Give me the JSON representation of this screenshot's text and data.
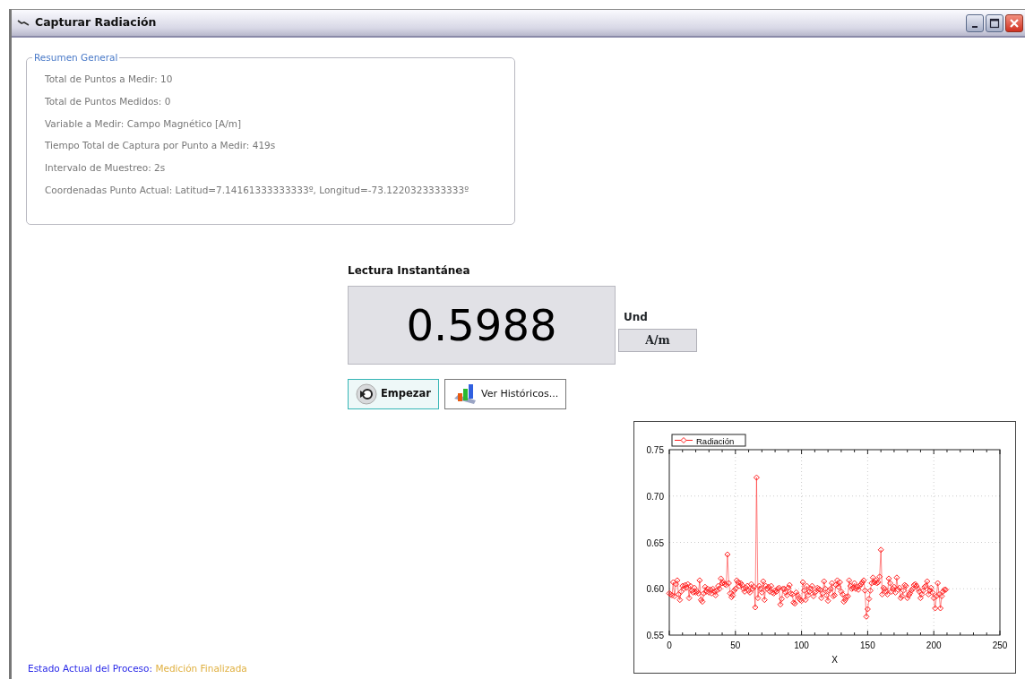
{
  "window": {
    "title": "Capturar Radiación"
  },
  "summary": {
    "legend": "Resumen General",
    "items": [
      "Total de Puntos a Medir: 10",
      "Total de Puntos Medidos: 0",
      "Variable a Medir: Campo Magnético [A/m]",
      "Tiempo Total de Captura por Punto a Medir: 419s",
      "Intervalo de Muestreo: 2s",
      "Coordenadas Punto Actual: Latitud=7.14161333333333º, Longitud=-73.1220323333333º"
    ]
  },
  "reading": {
    "title": "Lectura Instantánea",
    "value": "0.5988",
    "unit_label": "Und",
    "unit": "A/m"
  },
  "buttons": [
    {
      "label": "Empezar",
      "kind": "start"
    },
    {
      "label": "Ver Históricos...",
      "kind": "history"
    }
  ],
  "chart": {
    "chart_data": {
      "type": "line",
      "xlabel": "X",
      "grid": true,
      "xlim": [
        0,
        250
      ],
      "ylim": [
        0.55,
        0.75
      ],
      "x": [
        0,
        1,
        2,
        3,
        4,
        5,
        6,
        7,
        8,
        9,
        10,
        11,
        12,
        13,
        14,
        15,
        16,
        17,
        18,
        19,
        20,
        21,
        22,
        23,
        24,
        25,
        26,
        27,
        28,
        29,
        30,
        31,
        32,
        33,
        34,
        35,
        36,
        37,
        38,
        39,
        40,
        41,
        42,
        43,
        44,
        45,
        46,
        47,
        48,
        49,
        50,
        51,
        52,
        53,
        54,
        55,
        56,
        57,
        58,
        59,
        60,
        61,
        62,
        63,
        64,
        65,
        66,
        67,
        68,
        69,
        70,
        71,
        72,
        73,
        74,
        75,
        76,
        77,
        78,
        79,
        80,
        81,
        82,
        83,
        84,
        85,
        86,
        87,
        88,
        89,
        90,
        91,
        92,
        93,
        94,
        95,
        96,
        97,
        98,
        99,
        100,
        101,
        102,
        103,
        104,
        105,
        106,
        107,
        108,
        109,
        110,
        111,
        112,
        113,
        114,
        115,
        116,
        117,
        118,
        119,
        120,
        121,
        122,
        123,
        124,
        125,
        126,
        127,
        128,
        129,
        130,
        131,
        132,
        133,
        134,
        135,
        136,
        137,
        138,
        139,
        140,
        141,
        142,
        143,
        144,
        145,
        146,
        147,
        148,
        149,
        150,
        151,
        152,
        153,
        154,
        155,
        156,
        157,
        158,
        159,
        160,
        161,
        162,
        163,
        164,
        165,
        166,
        167,
        168,
        169,
        170,
        171,
        172,
        173,
        174,
        175,
        176,
        177,
        178,
        179,
        180,
        181,
        182,
        183,
        184,
        185,
        186,
        187,
        188,
        189,
        190,
        191,
        192,
        193,
        194,
        195,
        196,
        197,
        198,
        199,
        200,
        201,
        202,
        203,
        204,
        205,
        206,
        207,
        208,
        209
      ],
      "xticks": [
        0,
        50,
        100,
        150,
        200,
        250
      ],
      "yticks": [
        {
          "value": 0.55,
          "label": "0.55"
        },
        {
          "value": 0.6,
          "label": "0.60"
        },
        {
          "value": 0.65,
          "label": "0.65"
        },
        {
          "value": 0.7,
          "label": "0.70"
        },
        {
          "value": 0.75,
          "label": "0.75"
        }
      ],
      "series": [
        {
          "name": "Radiación",
          "color": "#ff2020",
          "marker": "diamond",
          "values": [
            0.595,
            0.594,
            0.593,
            0.607,
            0.592,
            0.605,
            0.609,
            0.594,
            0.588,
            0.597,
            0.603,
            0.6,
            0.604,
            0.601,
            0.605,
            0.59,
            0.603,
            0.598,
            0.596,
            0.601,
            0.596,
            0.597,
            0.595,
            0.609,
            0.588,
            0.586,
            0.595,
            0.602,
            0.597,
            0.6,
            0.596,
            0.599,
            0.595,
            0.6,
            0.597,
            0.593,
            0.598,
            0.603,
            0.6,
            0.611,
            0.606,
            0.607,
            0.605,
            0.604,
            0.637,
            0.606,
            0.595,
            0.591,
            0.593,
            0.598,
            0.6,
            0.609,
            0.607,
            0.603,
            0.606,
            0.604,
            0.6,
            0.597,
            0.601,
            0.603,
            0.598,
            0.596,
            0.605,
            0.6,
            0.602,
            0.58,
            0.72,
            0.59,
            0.603,
            0.6,
            0.596,
            0.608,
            0.588,
            0.603,
            0.6,
            0.602,
            0.597,
            0.603,
            0.596,
            0.595,
            0.598,
            0.597,
            0.6,
            0.601,
            0.583,
            0.589,
            0.6,
            0.6,
            0.596,
            0.593,
            0.601,
            0.604,
            0.595,
            0.594,
            0.585,
            0.584,
            0.596,
            0.593,
            0.59,
            0.588,
            0.587,
            0.607,
            0.598,
            0.588,
            0.603,
            0.593,
            0.597,
            0.6,
            0.603,
            0.592,
            0.596,
            0.597,
            0.601,
            0.6,
            0.599,
            0.59,
            0.595,
            0.608,
            0.6,
            0.593,
            0.587,
            0.598,
            0.6,
            0.606,
            0.592,
            0.593,
            0.604,
            0.609,
            0.602,
            0.607,
            0.597,
            0.594,
            0.586,
            0.588,
            0.591,
            0.592,
            0.609,
            0.603,
            0.6,
            0.601,
            0.606,
            0.6,
            0.602,
            0.599,
            0.603,
            0.605,
            0.607,
            0.609,
            0.598,
            0.57,
            0.578,
            0.589,
            0.598,
            0.606,
            0.612,
            0.607,
            0.609,
            0.606,
            0.607,
            0.613,
            0.642,
            0.594,
            0.601,
            0.6,
            0.597,
            0.594,
            0.611,
            0.606,
            0.597,
            0.6,
            0.602,
            0.596,
            0.612,
            0.599,
            0.601,
            0.59,
            0.592,
            0.598,
            0.604,
            0.603,
            0.59,
            0.593,
            0.595,
            0.598,
            0.6,
            0.604,
            0.605,
            0.603,
            0.6,
            0.597,
            0.59,
            0.594,
            0.598,
            0.602,
            0.603,
            0.608,
            0.594,
            0.598,
            0.601,
            0.596,
            0.59,
            0.579,
            0.592,
            0.606,
            0.594,
            0.579,
            0.592,
            0.597,
            0.599,
            0.599
          ]
        }
      ]
    }
  },
  "status": {
    "label": "Estado Actual del Proceso:",
    "value": "Medición Finalizada"
  }
}
